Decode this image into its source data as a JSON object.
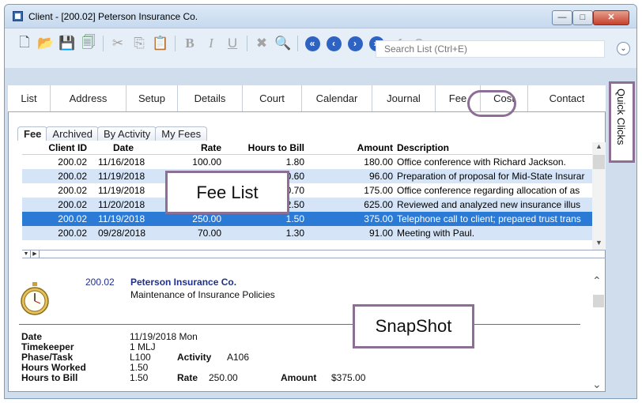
{
  "window": {
    "title": "Client - [200.02] Peterson Insurance Co.",
    "min_label": "—",
    "max_label": "□",
    "close_label": "✕"
  },
  "toolbar": {
    "icons": [
      "new-document-icon",
      "open-folder-icon",
      "save-icon",
      "notes-icon",
      "cut-icon",
      "copy-icon",
      "paste-icon",
      "bold-icon",
      "italic-icon",
      "underline-icon",
      "delete-icon",
      "lookup-icon",
      "first-record-icon",
      "previous-record-icon",
      "next-record-icon",
      "last-record-icon",
      "confirm-icon",
      "cancel-icon"
    ]
  },
  "search": {
    "placeholder": "Search List (Ctrl+E)"
  },
  "main_tabs": [
    {
      "label": "List"
    },
    {
      "label": "Address"
    },
    {
      "label": "Setup"
    },
    {
      "label": "Details"
    },
    {
      "label": "Court"
    },
    {
      "label": "Calendar"
    },
    {
      "label": "Journal"
    },
    {
      "label": "Fee"
    },
    {
      "label": "Cost"
    },
    {
      "label": "Contact"
    }
  ],
  "sub_tabs": [
    {
      "label": "Fee"
    },
    {
      "label": "Archived"
    },
    {
      "label": "By Activity"
    },
    {
      "label": "My Fees"
    }
  ],
  "grid": {
    "headers": {
      "client_id": "Client ID",
      "date": "Date",
      "rate": "Rate",
      "hours": "Hours to Bill",
      "amount": "Amount",
      "description": "Description"
    },
    "rows": [
      {
        "client_id": "200.02",
        "date": "11/16/2018",
        "rate": "100.00",
        "hours": "1.80",
        "amount": "180.00",
        "description": "Office conference with Richard Jackson."
      },
      {
        "client_id": "200.02",
        "date": "11/19/2018",
        "rate": "",
        "hours": "0.60",
        "amount": "96.00",
        "description": "Preparation of proposal for Mid-State Insurar"
      },
      {
        "client_id": "200.02",
        "date": "11/19/2018",
        "rate": "",
        "hours": "0.70",
        "amount": "175.00",
        "description": "Office conference regarding allocation of as"
      },
      {
        "client_id": "200.02",
        "date": "11/20/2018",
        "rate": "",
        "hours": "2.50",
        "amount": "625.00",
        "description": "Reviewed and analyzed new insurance illus"
      },
      {
        "client_id": "200.02",
        "date": "11/19/2018",
        "rate": "250.00",
        "hours": "1.50",
        "amount": "375.00",
        "description": "Telephone call to client; prepared trust trans"
      },
      {
        "client_id": "200.02",
        "date": "09/28/2018",
        "rate": "70.00",
        "hours": "1.30",
        "amount": "91.00",
        "description": "Meeting with Paul."
      }
    ]
  },
  "callouts": {
    "fee_list": "Fee List",
    "snapshot": "SnapShot",
    "quick_clicks": "Quick Clicks"
  },
  "snapshot": {
    "client_id": "200.02",
    "client_name": "Peterson Insurance Co.",
    "matter": "Maintenance of Insurance Policies",
    "labels": {
      "date": "Date",
      "timekeeper": "Timekeeper",
      "phase_task": "Phase/Task",
      "activity": "Activity",
      "hours_worked": "Hours Worked",
      "hours_to_bill": "Hours to Bill",
      "rate": "Rate",
      "amount": "Amount"
    },
    "values": {
      "date": "11/19/2018 Mon",
      "timekeeper": "1  MLJ",
      "phase_task": "L100",
      "activity": "A106",
      "hours_worked": "1.50",
      "hours_to_bill": "1.50",
      "rate": "250.00",
      "amount": "$375.00"
    }
  },
  "colors": {
    "selected_row": "#2a7ad6",
    "alt_row": "#d5e5f7",
    "callout_border": "#8d6e95",
    "client_text": "#1e2f8e"
  }
}
